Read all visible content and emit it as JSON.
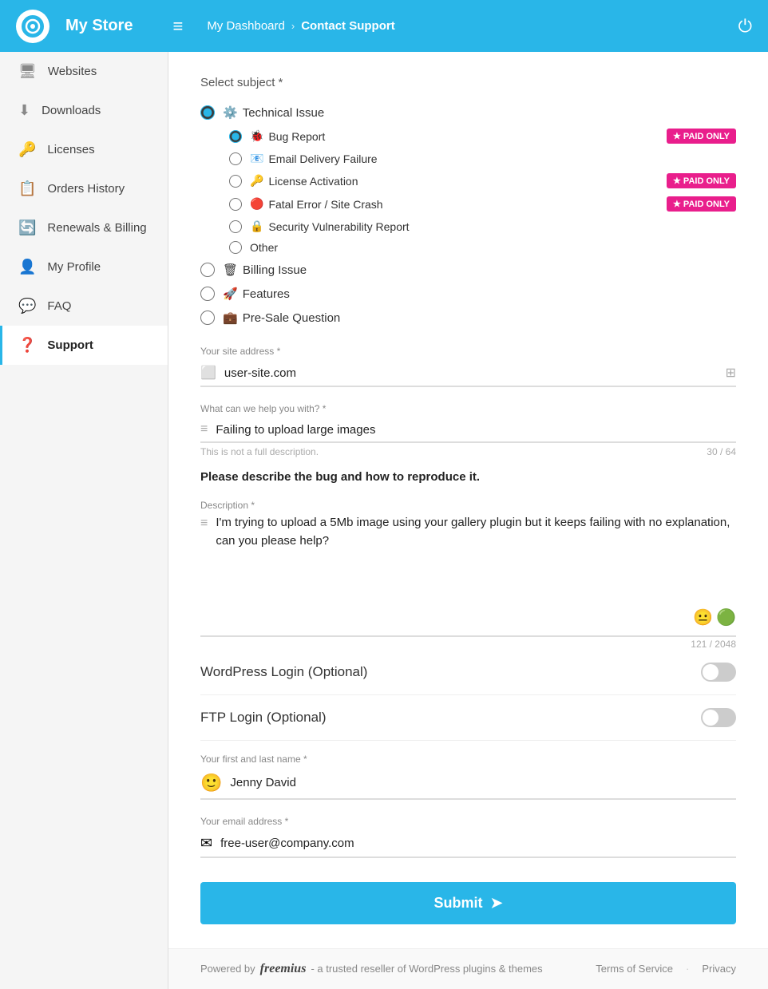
{
  "header": {
    "store_name": "My Store",
    "breadcrumb_home": "My Dashboard",
    "breadcrumb_current": "Contact Support"
  },
  "sidebar": {
    "items": [
      {
        "id": "websites",
        "label": "Websites",
        "icon": "🖥"
      },
      {
        "id": "downloads",
        "label": "Downloads",
        "icon": "⬇"
      },
      {
        "id": "licenses",
        "label": "Licenses",
        "icon": "🔑"
      },
      {
        "id": "orders",
        "label": "Orders History",
        "icon": "📋"
      },
      {
        "id": "renewals",
        "label": "Renewals & Billing",
        "icon": "🔄"
      },
      {
        "id": "profile",
        "label": "My Profile",
        "icon": "👤"
      },
      {
        "id": "faq",
        "label": "FAQ",
        "icon": "💬"
      },
      {
        "id": "support",
        "label": "Support",
        "icon": "❓"
      }
    ]
  },
  "form": {
    "select_subject_label": "Select subject *",
    "subjects": [
      {
        "id": "technical",
        "label": "Technical Issue",
        "emoji": "⚙️",
        "selected": true
      },
      {
        "id": "billing",
        "label": "Billing Issue",
        "emoji": "🗑",
        "selected": false
      },
      {
        "id": "features",
        "label": "Features",
        "emoji": "🚀",
        "selected": false
      },
      {
        "id": "presale",
        "label": "Pre-Sale Question",
        "emoji": "💼",
        "selected": false
      }
    ],
    "sub_subjects": [
      {
        "id": "bug",
        "label": "Bug Report",
        "emoji": "🐞",
        "selected": true,
        "badge": "PAID ONLY"
      },
      {
        "id": "email",
        "label": "Email Delivery Failure",
        "emoji": "📧",
        "selected": false,
        "badge": ""
      },
      {
        "id": "license",
        "label": "License Activation",
        "emoji": "🔑",
        "selected": false,
        "badge": "PAID ONLY"
      },
      {
        "id": "fatal",
        "label": "Fatal Error / Site Crash",
        "emoji": "🔴",
        "selected": false,
        "badge": "PAID ONLY"
      },
      {
        "id": "security",
        "label": "Security Vulnerability Report",
        "emoji": "🔒",
        "selected": false,
        "badge": ""
      },
      {
        "id": "other",
        "label": "Other",
        "emoji": "",
        "selected": false,
        "badge": ""
      }
    ],
    "site_address_label": "Your site address *",
    "site_address_value": "user-site.com",
    "what_help_label": "What can we help you with? *",
    "what_help_value": "Failing to upload large images",
    "what_help_hint": "This is not a full description.",
    "what_help_count": "30 / 64",
    "bug_prompt": "Please describe the bug and how to reproduce it.",
    "description_label": "Description *",
    "description_value": "I'm trying to upload a 5Mb image using your gallery plugin but it keeps failing with no explanation, can you please help?",
    "description_count": "121 / 2048",
    "wp_login_label": "WordPress Login (Optional)",
    "ftp_login_label": "FTP Login (Optional)",
    "name_label": "Your first and last name *",
    "name_value": "Jenny David",
    "email_label": "Your email address *",
    "email_value": "free-user@company.com",
    "submit_label": "Submit"
  },
  "footer": {
    "powered_by": "Powered by",
    "brand": "freemius",
    "tagline": "- a trusted reseller of WordPress plugins & themes",
    "terms_label": "Terms of Service",
    "privacy_label": "Privacy"
  }
}
